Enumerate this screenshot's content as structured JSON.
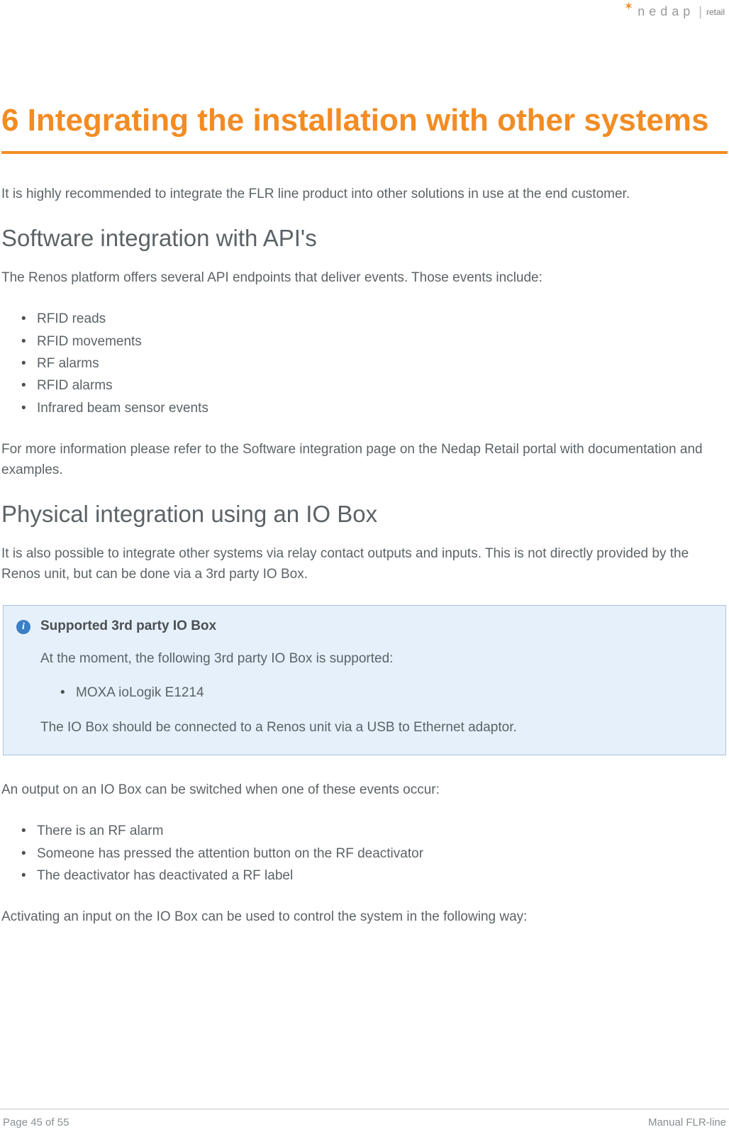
{
  "header": {
    "brand_word": "nedap",
    "brand_suffix": "retail"
  },
  "main": {
    "heading": "6 Integrating the installation with other systems",
    "intro": "It is highly recommended to integrate the FLR line product into other solutions in use at the end customer.",
    "section1_heading": "Software integration with API's",
    "section1_intro": "The Renos platform offers several API endpoints that deliver events. Those events include:",
    "section1_items": {
      "0": "RFID reads",
      "1": "RFID movements",
      "2": "RF alarms",
      "3": "RFID alarms",
      "4": "Infrared beam sensor events"
    },
    "section1_outro": "For more information please refer to the Software integration page on the Nedap Retail portal with documentation and examples.",
    "section2_heading": "Physical integration using an IO Box",
    "section2_intro": "It is also possible to integrate other systems via relay contact outputs and inputs. This is not directly provided by the Renos unit, but can be done via a 3rd party IO Box.",
    "infobox": {
      "title": "Supported 3rd party IO Box",
      "text1": "At the moment, the following 3rd party IO Box is supported:",
      "items": {
        "0": "MOXA ioLogik E1214"
      },
      "text2": "The IO Box should be connected to a Renos unit via a USB to Ethernet adaptor."
    },
    "section2_events_intro": "An output on an IO Box can be switched when one of these events occur:",
    "section2_events": {
      "0": "There is an RF alarm",
      "1": "Someone has pressed the attention button on the RF deactivator",
      "2": "The deactivator has deactivated a RF label"
    },
    "section2_input_intro": "Activating an input on the IO Box can be used to control the system in the following way:"
  },
  "footer": {
    "page": "Page 45 of 55",
    "doc": "Manual FLR-line"
  }
}
